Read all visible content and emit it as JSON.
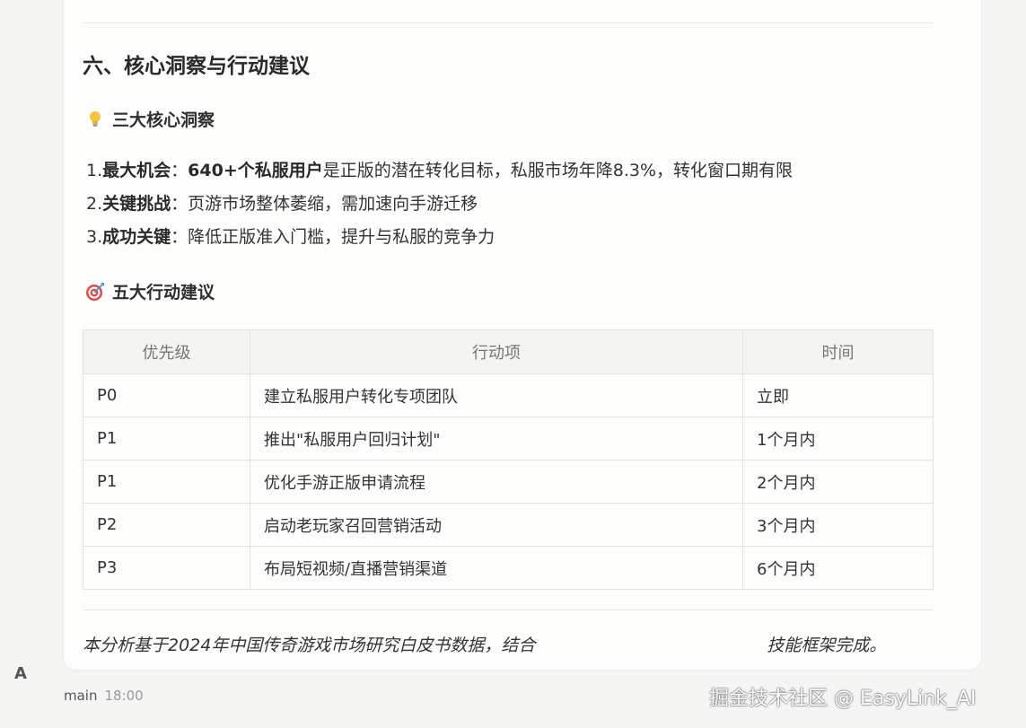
{
  "section": {
    "title": "六、核心洞察与行动建议"
  },
  "insights": {
    "icon": "lightbulb-icon",
    "heading": "三大核心洞察",
    "items": [
      {
        "num": "1.",
        "label": "最大机会",
        "sep": "：",
        "strong": "640+个私服用户",
        "text": "是正版的潜在转化目标，私服市场年降8.3%，转化窗口期有限"
      },
      {
        "num": "2.",
        "label": "关键挑战",
        "sep": "：",
        "strong": "",
        "text": "页游市场整体萎缩，需加速向手游迁移"
      },
      {
        "num": "3.",
        "label": "成功关键",
        "sep": "：",
        "strong": "",
        "text": "降低正版准入门槛，提升与私服的竞争力"
      }
    ]
  },
  "actions": {
    "icon": "target-icon",
    "heading": "五大行动建议",
    "columns": [
      "优先级",
      "行动项",
      "时间"
    ],
    "rows": [
      {
        "priority": "P0",
        "action": "建立私服用户转化专项团队",
        "time": "立即"
      },
      {
        "priority": "P1",
        "action": "推出\"私服用户回归计划\"",
        "time": "1个月内"
      },
      {
        "priority": "P1",
        "action": "优化手游正版申请流程",
        "time": "2个月内"
      },
      {
        "priority": "P2",
        "action": "启动老玩家召回营销活动",
        "time": "3个月内"
      },
      {
        "priority": "P3",
        "action": "布局短视频/直播营销渠道",
        "time": "6个月内"
      }
    ]
  },
  "note": {
    "before": "本分析基于2024年中国传奇游戏市场研究白皮书数据，结合",
    "after": "技能框架完成。"
  },
  "message_meta": {
    "avatar": "A",
    "sender": "main",
    "time": "18:00"
  },
  "watermark": "掘金技术社区 @ EasyLink_AI"
}
